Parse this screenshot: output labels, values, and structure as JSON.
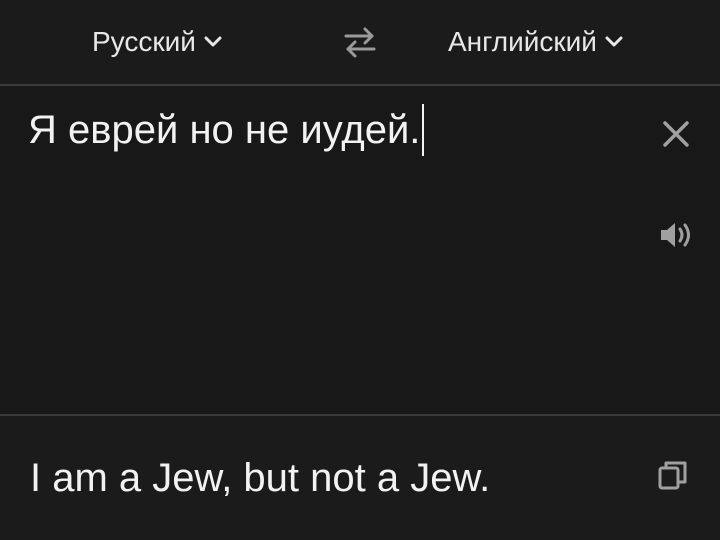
{
  "languages": {
    "source": "Русский",
    "target": "Английский"
  },
  "input": {
    "text": "Я еврей но не иудей."
  },
  "output": {
    "translation": "I am a Jew, but not a Jew."
  },
  "icons": {
    "source_chevron": "chevron-down-icon",
    "target_chevron": "chevron-down-icon",
    "swap": "swap-arrows-icon",
    "clear": "close-icon",
    "speak": "speaker-icon",
    "copy": "copy-icon"
  },
  "colors": {
    "background": "#1b1b1b",
    "text": "#f2f2f2",
    "icon": "#9a9a9a",
    "divider": "#3a3a3a"
  }
}
